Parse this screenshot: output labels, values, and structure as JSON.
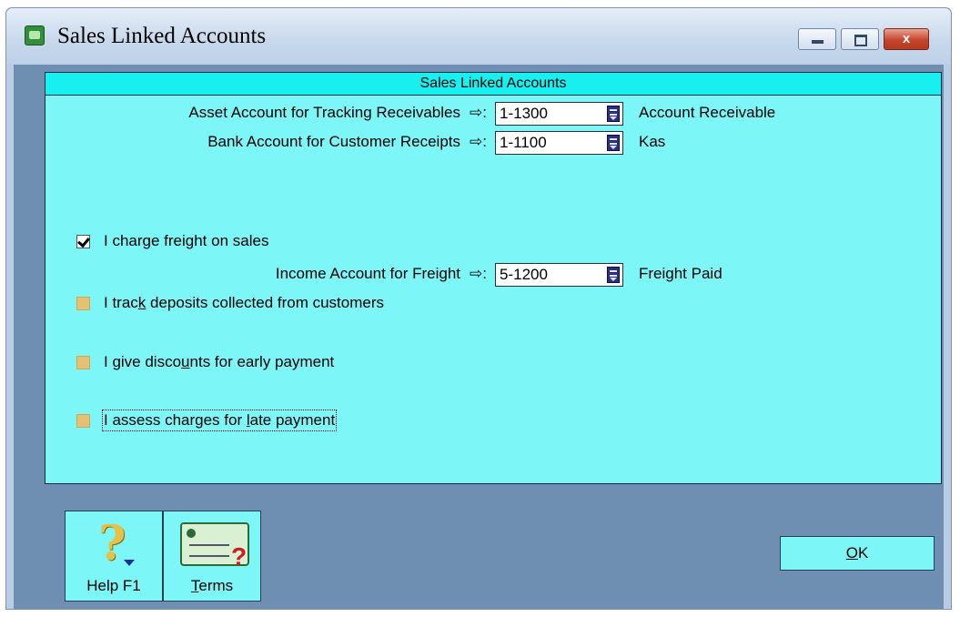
{
  "window": {
    "title": "Sales Linked Accounts",
    "controls": {
      "minimize": "",
      "maximize": "",
      "close": "x"
    }
  },
  "panel": {
    "header": "Sales Linked Accounts",
    "arrow_symbol": "⇨:",
    "receivables": {
      "label": "Asset Account for Tracking Receivables",
      "account": "1-1300",
      "account_name": "Account Receivable"
    },
    "receipts": {
      "label": "Bank Account for Customer Receipts",
      "account": "1-1100",
      "account_name": "Kas"
    },
    "freight_checkbox": {
      "label": "I charge freight on sales",
      "checked": true
    },
    "freight": {
      "label": "Income Account for Freight",
      "account": "5-1200",
      "account_name": "Freight Paid"
    },
    "deposits_checkbox": {
      "label_a": "I trac",
      "label_u": "k",
      "label_b": " deposits collected from customers",
      "checked": false
    },
    "discounts_checkbox": {
      "label_a": "I give disco",
      "label_u": "u",
      "label_b": "nts for early payment",
      "checked": false
    },
    "late_checkbox": {
      "label_a": "I assess charges for ",
      "label_u": "l",
      "label_b": "ate payment",
      "checked": false
    }
  },
  "buttons": {
    "help": "Help F1",
    "terms_u": "T",
    "terms_rest": "erms",
    "ok_u": "O",
    "ok_rest": "K"
  },
  "colors": {
    "panel_bg": "#7df6f7",
    "header_bg": "#18f0f0",
    "client_bg": "#6e8fb2",
    "checkbox_unchecked": "#e5c173"
  },
  "icons": {
    "app": "app-icon",
    "help": "question-mark-icon",
    "terms": "terms-card-icon",
    "list": "list-lookup-icon"
  }
}
